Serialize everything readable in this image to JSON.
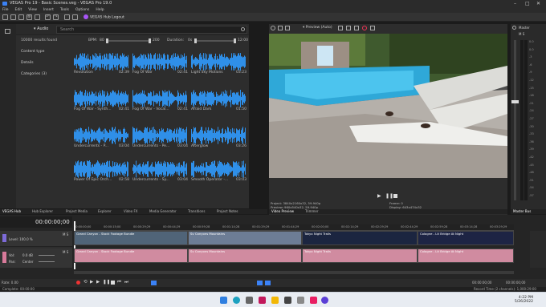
{
  "window": {
    "title": "VEGAS Pro 19 - Basic Scenes.veg - VEGAS Pro 19.0"
  },
  "menu": [
    "File",
    "Edit",
    "View",
    "Insert",
    "Tools",
    "Options",
    "Help"
  ],
  "toolbar": {
    "hub_logout": "VEGAS Hub Logout"
  },
  "hub": {
    "audio_label": "Audio",
    "search_placeholder": "Search",
    "results": "10000 results found",
    "bpm_label": "BPM:",
    "bpm_min": "80",
    "bpm_max": "200",
    "duration_label": "Duration:",
    "duration_min": "0s",
    "duration_max": "12:00",
    "categories": [
      "Content type",
      "Details",
      "Categories (3)"
    ],
    "tiles": [
      {
        "title": "Revolution",
        "duration": "02:39"
      },
      {
        "title": "Fog Of War",
        "duration": "02:41"
      },
      {
        "title": "Light Sky Motions",
        "duration": "03:23"
      },
      {
        "title": "Fog Of War - Synth...",
        "duration": "02:41"
      },
      {
        "title": "Fog Of War - Vocal...",
        "duration": "02:41"
      },
      {
        "title": "Afraid Dark",
        "duration": "01:50"
      },
      {
        "title": "Undercurrents - P...",
        "duration": "03:04"
      },
      {
        "title": "Undercurrents - Pe...",
        "duration": "03:04"
      },
      {
        "title": "Afterglow",
        "duration": "03:26"
      },
      {
        "title": "Power Of Epic Orch...",
        "duration": "02:58"
      },
      {
        "title": "Undercurrents - Sy...",
        "duration": "03:04"
      },
      {
        "title": "Smooth Operator -...",
        "duration": "03:03"
      }
    ]
  },
  "left_tabs": [
    "VEGAS Hub",
    "Hub Explorer",
    "Project Media",
    "Explorer",
    "Video FX",
    "Media Generator",
    "Transitions",
    "Project Notes"
  ],
  "preview": {
    "mode": "Preview (Auto)",
    "project": "Project: 3840x2160x32, 59.940p",
    "preview_res": "Preview: 960x540x32, 59.940p",
    "frame": "Frame: 0",
    "display": "Display: 643x474x32",
    "tabs": [
      "Video Preview",
      "Trimmer"
    ]
  },
  "master": {
    "label": "Master",
    "tab": "Master Bus",
    "scale": [
      "0.0",
      "0.0",
      "-3",
      "-6",
      "-9",
      "-12",
      "-15",
      "-18",
      "-21",
      "-24",
      "-27",
      "-30",
      "-33",
      "-36",
      "-39",
      "-42",
      "-45",
      "-48",
      "-51",
      "-54",
      "-57"
    ]
  },
  "timeline": {
    "timecode": "00:00:00;00",
    "ruler": [
      "00:00:00;00",
      "00:00:15;00",
      "00:00:29;29",
      "00:00:44;29",
      "00:00:59;28",
      "00:01:14;28",
      "00:01:29;29",
      "00:01:44;29",
      "00:02:00;00",
      "00:02:14;29",
      "00:02:29;29",
      "00:02:44;29",
      "00:02:59;28",
      "00:03:14;28",
      "00:03:29;29"
    ],
    "video_track": {
      "level": "Level: 100.0 %"
    },
    "audio_track": {
      "vol": "Vol:",
      "vol_value": "0.0 dB",
      "pan": "Pan:",
      "pan_value": "Center"
    },
    "video_clips": [
      "Grand Canyon - Stock Footage Bundle",
      "Sv Canyons Mountains",
      "Tokyo Night Trails",
      "Cologne - Lit Bridge At Night"
    ],
    "audio_clips": [
      "Grand Canyon - Stock Footage Bundle",
      "Sv Canyons Mountains",
      "Tokyo Night Trails",
      "Cologne - Lit Bridge At Night"
    ],
    "rate": "Rate: 0.00",
    "transport_time": "00:00:00;00",
    "end_time": "00:00:00;00"
  },
  "status": {
    "text": "Complete: 00:00:00",
    "record": "Record Time (2 channels): 1,000:29:00"
  },
  "taskbar": {
    "time": "4:22 PM",
    "date": "5/26/2022"
  }
}
